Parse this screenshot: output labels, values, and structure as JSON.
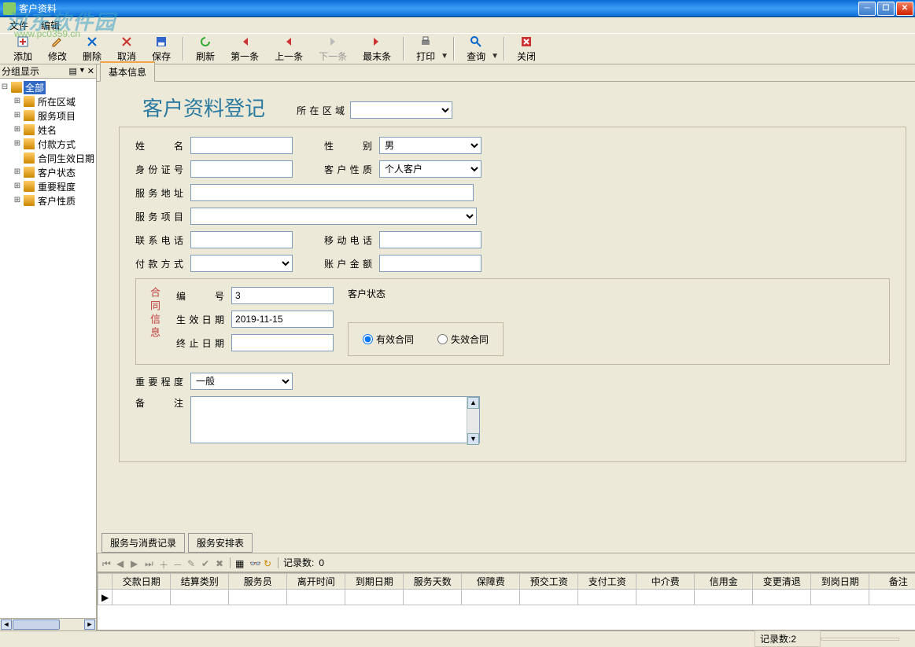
{
  "watermark": {
    "text": "河东软件园",
    "url": "www.pc0359.cn"
  },
  "window": {
    "title": "客户资料"
  },
  "menu": {
    "file": "文件",
    "edit": "编辑"
  },
  "toolbar": {
    "add": "添加",
    "edit": "修改",
    "del": "删除",
    "cancel": "取消",
    "save": "保存",
    "refresh": "刷新",
    "first": "第一条",
    "prev": "上一条",
    "next": "下一条",
    "last": "最末条",
    "print": "打印",
    "query": "查询",
    "close": "关闭"
  },
  "sidebar": {
    "header": "分组显示",
    "root": "全部",
    "items": [
      "所在区域",
      "服务项目",
      "姓名",
      "付款方式",
      "合同生效日期",
      "客户状态",
      "重要程度",
      "客户性质"
    ]
  },
  "tabs": {
    "basic": "基本信息"
  },
  "form": {
    "title": "客户资料登记",
    "region_label": "所在区域",
    "region_value": "",
    "name_label": "姓    名",
    "name_value": "",
    "gender_label": "性    别",
    "gender_value": "男",
    "idnum_label": "身份证号",
    "idnum_value": "",
    "nature_label": "客户性质",
    "nature_value": "个人客户",
    "service_addr_label": "服务地址",
    "service_addr_value": "",
    "service_item_label": "服务项目",
    "service_item_value": "",
    "phone_label": "联系电话",
    "phone_value": "",
    "mobile_label": "移动电话",
    "mobile_value": "",
    "pay_method_label": "付款方式",
    "pay_method_value": "",
    "acct_amount_label": "账户金额",
    "acct_amount_value": "",
    "contract_section": "合同信息",
    "code_label": "编    号",
    "code_value": "3",
    "start_date_label": "生效日期",
    "start_date_value": "2019-11-15",
    "end_date_label": "终止日期",
    "end_date_value": "",
    "state_label": "客户状态",
    "state_valid": "有效合同",
    "state_invalid": "失效合同",
    "importance_label": "重要程度",
    "importance_value": "一般",
    "remark_label": "备    注",
    "remark_value": ""
  },
  "sub_tabs": {
    "svc_record": "服务与消费记录",
    "svc_schedule": "服务安排表"
  },
  "grid_toolbar": {
    "binocular": "",
    "record_count_label": "记录数:",
    "record_count": "0"
  },
  "grid": {
    "columns": [
      "交款日期",
      "结算类别",
      "服务员",
      "离开时间",
      "到期日期",
      "服务天数",
      "保障费",
      "预交工资",
      "支付工资",
      "中介费",
      "信用金",
      "变更清退",
      "到岗日期",
      "备注"
    ]
  },
  "statusbar": {
    "record_count_label": "记录数:",
    "record_count": "2"
  }
}
